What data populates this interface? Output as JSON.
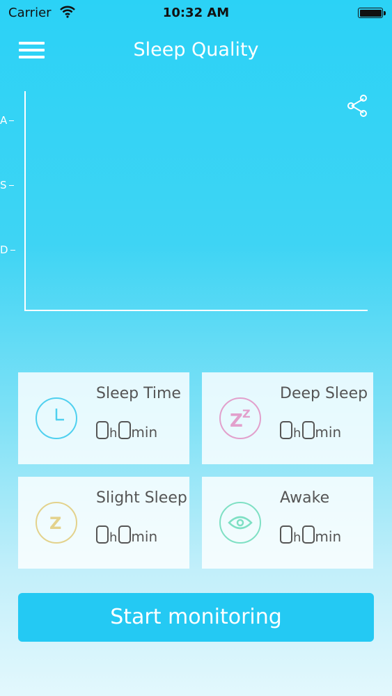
{
  "status_bar": {
    "carrier": "Carrier",
    "time": "10:32 AM"
  },
  "header": {
    "title": "Sleep Quality",
    "menu_icon": "hamburger-menu-icon"
  },
  "chart": {
    "share_icon": "share-icon",
    "y_labels": [
      "A",
      "S",
      "D"
    ]
  },
  "stats": [
    {
      "label": "Sleep Time",
      "hours": "0",
      "h_unit": "h",
      "minutes": "0",
      "min_unit": "min",
      "icon": "clock-icon",
      "color": "#4fd0ef"
    },
    {
      "label": "Deep Sleep",
      "hours": "0",
      "h_unit": "h",
      "minutes": "0",
      "min_unit": "min",
      "icon": "zz-icon",
      "color": "#e2a0cc"
    },
    {
      "label": "Slight Sleep",
      "hours": "0",
      "h_unit": "h",
      "minutes": "0",
      "min_unit": "min",
      "icon": "z-icon",
      "color": "#e3d28c"
    },
    {
      "label": "Awake",
      "hours": "0",
      "h_unit": "h",
      "minutes": "0",
      "min_unit": "min",
      "icon": "eye-icon",
      "color": "#7fe0c4"
    }
  ],
  "actions": {
    "start_label": "Start monitoring"
  }
}
